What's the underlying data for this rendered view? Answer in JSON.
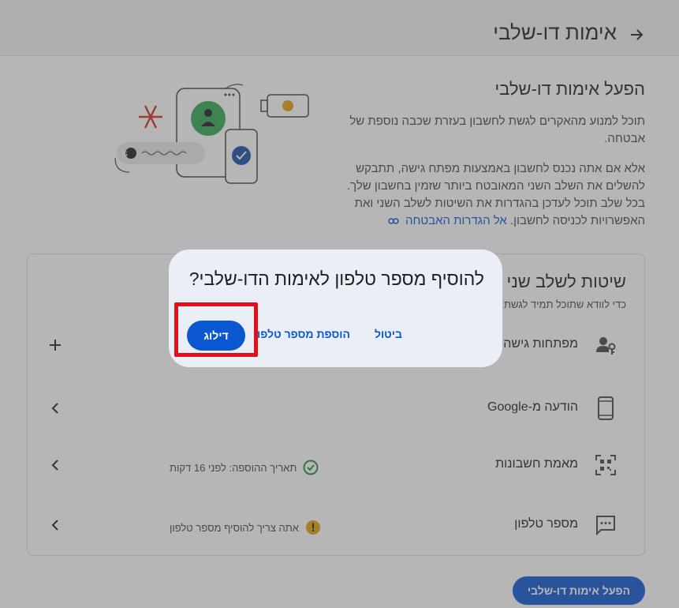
{
  "header": {
    "title": "אימות דו-שלבי",
    "back_icon": "arrow-back-icon"
  },
  "intro": {
    "title": "הפעל אימות דו-שלבי",
    "paragraph1": "תוכל למנוע מהאקרים לגשת לחשבון בעזרת שכבה נוספת של אבטחה.",
    "paragraph2": "אלא אם אתה נכנס לחשבון באמצעות מפתח גישה, תתבקש להשלים את השלב השני המאובטח ביותר שזמין בחשבון שלך. בכל שלב תוכל לעדכן בהגדרות את השיטות לשלב השני ואת האפשרויות לכניסה לחשבון.",
    "link_label": "אל הגדרות האבטחה"
  },
  "methods": {
    "title": "שיטות לשלב שני",
    "subtitle": "כדי לוודא שתוכל תמיד לגשת",
    "rows": [
      {
        "label": "מפתחות גישה ו",
        "icon": "person-key-icon",
        "action": "plus-icon",
        "status": ""
      },
      {
        "label": "הודעה מ-Google",
        "icon": "smartphone-icon",
        "action": "chevron-left-icon",
        "status": ""
      },
      {
        "label": "מאמת חשבונות",
        "icon": "qr-code-icon",
        "action": "chevron-left-icon",
        "status": "תאריך ההוספה: לפני 16 דקות",
        "status_icon": "check-circle-icon"
      },
      {
        "label": "מספר טלפון",
        "icon": "sms-icon",
        "action": "chevron-left-icon",
        "status": "אתה צריך להוסיף מספר טלפון",
        "status_icon": "warning-icon"
      }
    ]
  },
  "dialog": {
    "title": "להוסיף מספר טלפון לאימות הדו-שלבי?",
    "cancel_label": "ביטול",
    "add_label": "הוספת מספר טלפון",
    "skip_label": "דילוג"
  },
  "bottom_button": {
    "label": "הפעל אימות דו-שלבי"
  },
  "colors": {
    "accent": "#0b57d0",
    "highlight": "#e3101a",
    "success": "#1e8e3e",
    "warning": "#e3a008",
    "dialog_bg": "#eaeef6"
  }
}
